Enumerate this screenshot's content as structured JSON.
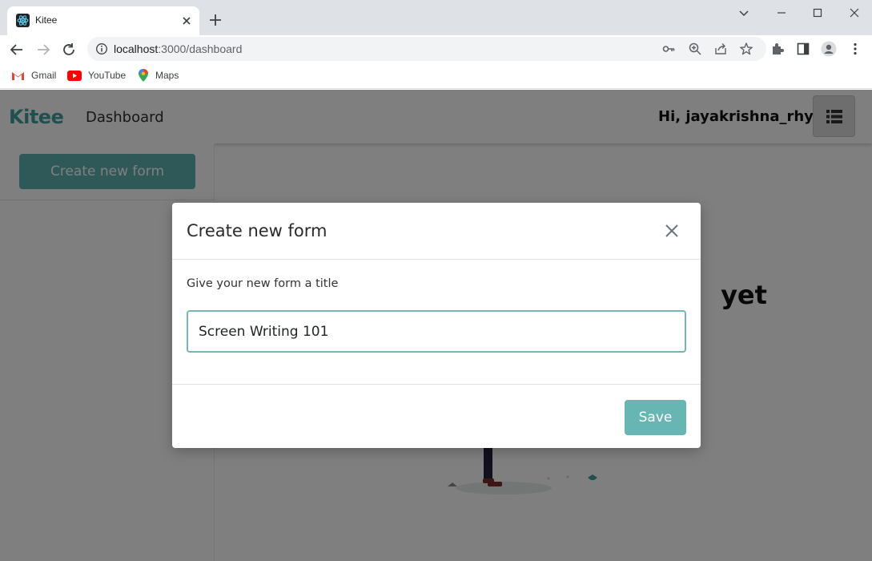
{
  "browser": {
    "tab_title": "Kitee",
    "url_host": "localhost",
    "url_path": ":3000/dashboard",
    "bookmarks": [
      {
        "label": "Gmail",
        "icon": "gmail-icon"
      },
      {
        "label": "YouTube",
        "icon": "youtube-icon"
      },
      {
        "label": "Maps",
        "icon": "maps-icon"
      }
    ]
  },
  "app": {
    "logo": "Kitee",
    "nav_dashboard": "Dashboard",
    "greeting": "Hi, jayakrishna_rhy",
    "create_button": "Create new form",
    "empty_title_visible": "yet"
  },
  "modal": {
    "title": "Create new form",
    "label": "Give your new form a title",
    "input_value": "Screen Writing 101",
    "save_label": "Save"
  },
  "colors": {
    "brand": "#3e9e9c",
    "button": "#5fb3b1",
    "input_focus_border": "#73b8b6"
  }
}
